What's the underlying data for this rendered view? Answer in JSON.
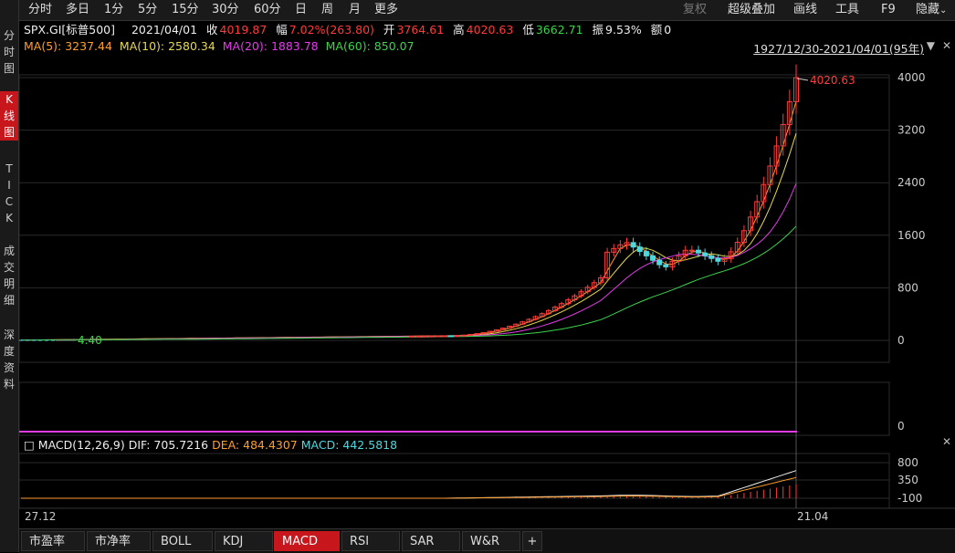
{
  "left_sidebar": {
    "items": [
      {
        "label": "分时图",
        "chars": [
          "分",
          "时",
          "图"
        ],
        "active": false
      },
      {
        "label": "K线图",
        "chars": [
          "K",
          "线",
          "图"
        ],
        "active": true
      },
      {
        "label": "TICK",
        "chars": [
          "T",
          "I",
          "C",
          "K"
        ],
        "active": false
      },
      {
        "label": "成交明细",
        "chars": [
          "成",
          "交",
          "明",
          "细"
        ],
        "active": false
      },
      {
        "label": "深度资料",
        "chars": [
          "深",
          "度",
          "资",
          "料"
        ],
        "active": false
      }
    ]
  },
  "period_tabs": [
    "分时",
    "多日",
    "1分",
    "5分",
    "15分",
    "30分",
    "60分",
    "日",
    "周",
    "月",
    "更多"
  ],
  "toolbar_right": {
    "restore": "复权",
    "overlay": "超级叠加",
    "draw": "画线",
    "tools": "工具",
    "f9": "F9",
    "hide": "隐藏"
  },
  "quote": {
    "symbol": "SPX.GI[标普500]",
    "date": "2021/04/01",
    "close_label": "收",
    "close": "4019.87",
    "change_label": "幅",
    "change": "7.02%(263.80)",
    "open_label": "开",
    "open": "3764.61",
    "high_label": "高",
    "high": "4020.63",
    "low_label": "低",
    "low": "3662.71",
    "amplitude_label": "振",
    "amplitude": "9.53%",
    "amount_label": "额",
    "amount": "0"
  },
  "ma": {
    "ma5": "MA(5): 3237.44",
    "ma10": "MA(10): 2580.34",
    "ma20": "MA(20): 1883.78",
    "ma60": "MA(60): 850.07"
  },
  "range_text": "1927/12/30-2021/04/01(95年)",
  "high_marker": "4020.63",
  "low_marker": "4.40",
  "macd_header": {
    "name": "MACD(12,26,9)",
    "dif": "DIF: 705.7216",
    "dea": "DEA: 484.4307",
    "macd": "MACD: 442.5818"
  },
  "axis": {
    "price_ticks": [
      "4000",
      "3200",
      "2400",
      "1600",
      "800",
      "0"
    ],
    "volume_ticks": [
      "0"
    ],
    "macd_ticks": [
      "800",
      "350",
      "-100"
    ],
    "date_start": "27.12",
    "date_end": "21.04"
  },
  "indicator_tabs": [
    {
      "label": "市盈率",
      "active": false
    },
    {
      "label": "市净率",
      "active": false
    },
    {
      "label": "BOLL",
      "active": false
    },
    {
      "label": "KDJ",
      "active": false
    },
    {
      "label": "MACD",
      "active": true
    },
    {
      "label": "RSI",
      "active": false
    },
    {
      "label": "SAR",
      "active": false
    },
    {
      "label": "W&R",
      "active": false
    },
    {
      "label": "+",
      "active": false
    }
  ],
  "colors": {
    "up": "#ff3b3b",
    "down": "#4dd8e0",
    "ma5": "#ff9d2d",
    "ma10": "#e7d84c",
    "ma20": "#e23be8",
    "ma60": "#3bd44a",
    "grid": "#2a2a2a",
    "accent": "#c8161d"
  }
}
